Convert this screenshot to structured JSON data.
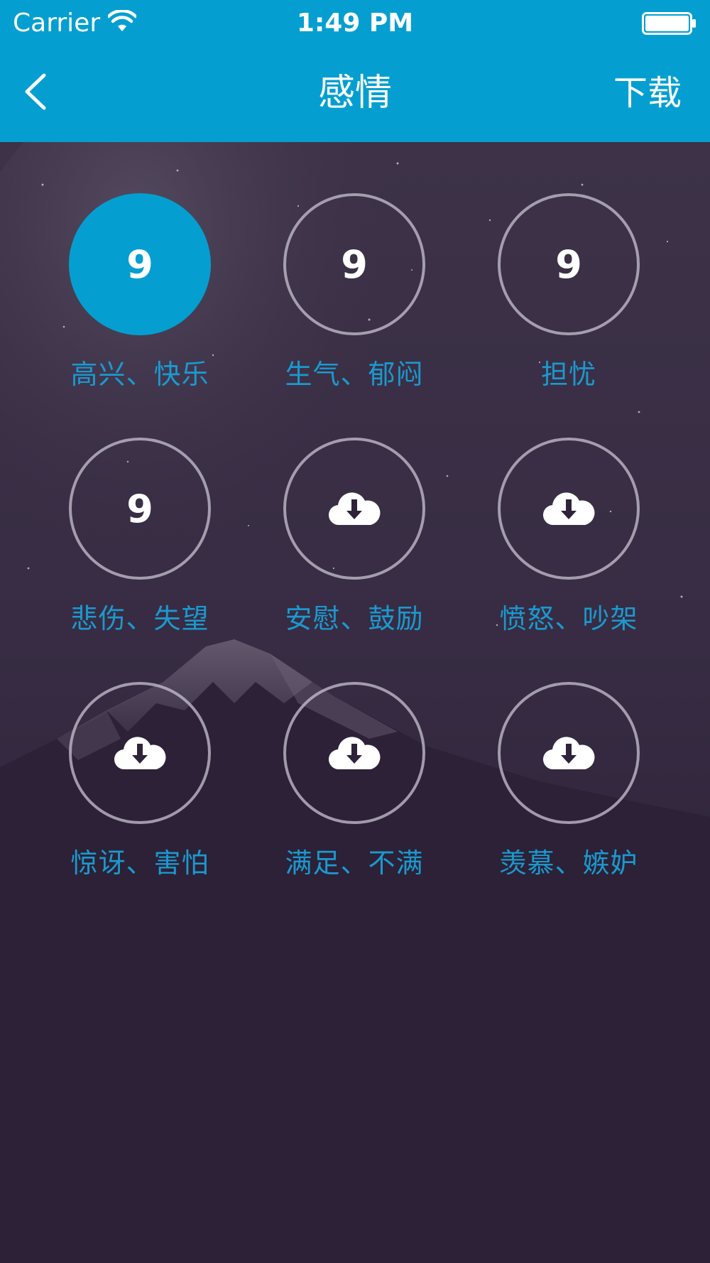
{
  "status_bar": {
    "carrier": "Carrier",
    "time": "1:49 PM"
  },
  "nav": {
    "title": "感情",
    "download_label": "下载"
  },
  "colors": {
    "accent": "#049fd0",
    "label": "#1b99cf",
    "background": "#241a2f"
  },
  "categories": [
    {
      "label": "高兴、快乐",
      "count": "9",
      "state": "selected"
    },
    {
      "label": "生气、郁闷",
      "count": "9",
      "state": "downloaded"
    },
    {
      "label": "担忧",
      "count": "9",
      "state": "downloaded"
    },
    {
      "label": "悲伤、失望",
      "count": "9",
      "state": "downloaded"
    },
    {
      "label": "安慰、鼓励",
      "icon": "cloud-download-icon",
      "state": "not-downloaded"
    },
    {
      "label": "愤怒、吵架",
      "icon": "cloud-download-icon",
      "state": "not-downloaded"
    },
    {
      "label": "惊讶、害怕",
      "icon": "cloud-download-icon",
      "state": "not-downloaded"
    },
    {
      "label": "满足、不满",
      "icon": "cloud-download-icon",
      "state": "not-downloaded"
    },
    {
      "label": "羡慕、嫉妒",
      "icon": "cloud-download-icon",
      "state": "not-downloaded"
    }
  ]
}
